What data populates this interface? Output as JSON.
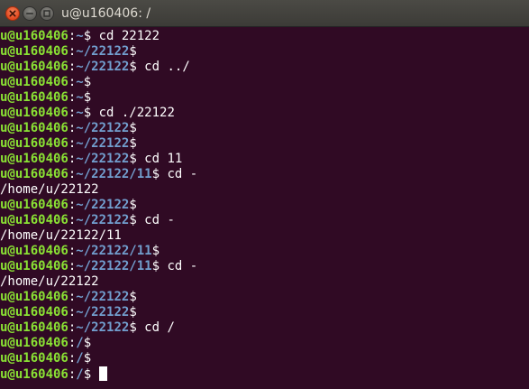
{
  "window": {
    "title": "u@u160406: /"
  },
  "terminal": {
    "lines": [
      {
        "type": "prompt",
        "user": "u@u160406",
        "path": "~",
        "cmd": "cd 22122"
      },
      {
        "type": "prompt",
        "user": "u@u160406",
        "path": "~/22122",
        "cmd": ""
      },
      {
        "type": "prompt",
        "user": "u@u160406",
        "path": "~/22122",
        "cmd": "cd ../"
      },
      {
        "type": "prompt",
        "user": "u@u160406",
        "path": "~",
        "cmd": ""
      },
      {
        "type": "prompt",
        "user": "u@u160406",
        "path": "~",
        "cmd": ""
      },
      {
        "type": "prompt",
        "user": "u@u160406",
        "path": "~",
        "cmd": "cd ./22122"
      },
      {
        "type": "prompt",
        "user": "u@u160406",
        "path": "~/22122",
        "cmd": ""
      },
      {
        "type": "prompt",
        "user": "u@u160406",
        "path": "~/22122",
        "cmd": ""
      },
      {
        "type": "prompt",
        "user": "u@u160406",
        "path": "~/22122",
        "cmd": "cd 11"
      },
      {
        "type": "prompt",
        "user": "u@u160406",
        "path": "~/22122/11",
        "cmd": "cd -"
      },
      {
        "type": "output",
        "text": "/home/u/22122"
      },
      {
        "type": "prompt",
        "user": "u@u160406",
        "path": "~/22122",
        "cmd": ""
      },
      {
        "type": "prompt",
        "user": "u@u160406",
        "path": "~/22122",
        "cmd": "cd -"
      },
      {
        "type": "output",
        "text": "/home/u/22122/11"
      },
      {
        "type": "prompt",
        "user": "u@u160406",
        "path": "~/22122/11",
        "cmd": ""
      },
      {
        "type": "prompt",
        "user": "u@u160406",
        "path": "~/22122/11",
        "cmd": "cd -"
      },
      {
        "type": "output",
        "text": "/home/u/22122"
      },
      {
        "type": "prompt",
        "user": "u@u160406",
        "path": "~/22122",
        "cmd": ""
      },
      {
        "type": "prompt",
        "user": "u@u160406",
        "path": "~/22122",
        "cmd": ""
      },
      {
        "type": "prompt",
        "user": "u@u160406",
        "path": "~/22122",
        "cmd": "cd /"
      },
      {
        "type": "prompt",
        "user": "u@u160406",
        "path": "/",
        "cmd": ""
      },
      {
        "type": "prompt",
        "user": "u@u160406",
        "path": "/",
        "cmd": ""
      },
      {
        "type": "prompt",
        "user": "u@u160406",
        "path": "/",
        "cmd": "",
        "cursor": true
      }
    ]
  },
  "colors": {
    "background": "#300a24",
    "user": "#8ae234",
    "path": "#729fcf",
    "text": "#ffffff",
    "close_button": "#e2481f"
  },
  "icons": {
    "close": "close-icon",
    "minimize": "minimize-icon",
    "maximize": "maximize-icon"
  }
}
